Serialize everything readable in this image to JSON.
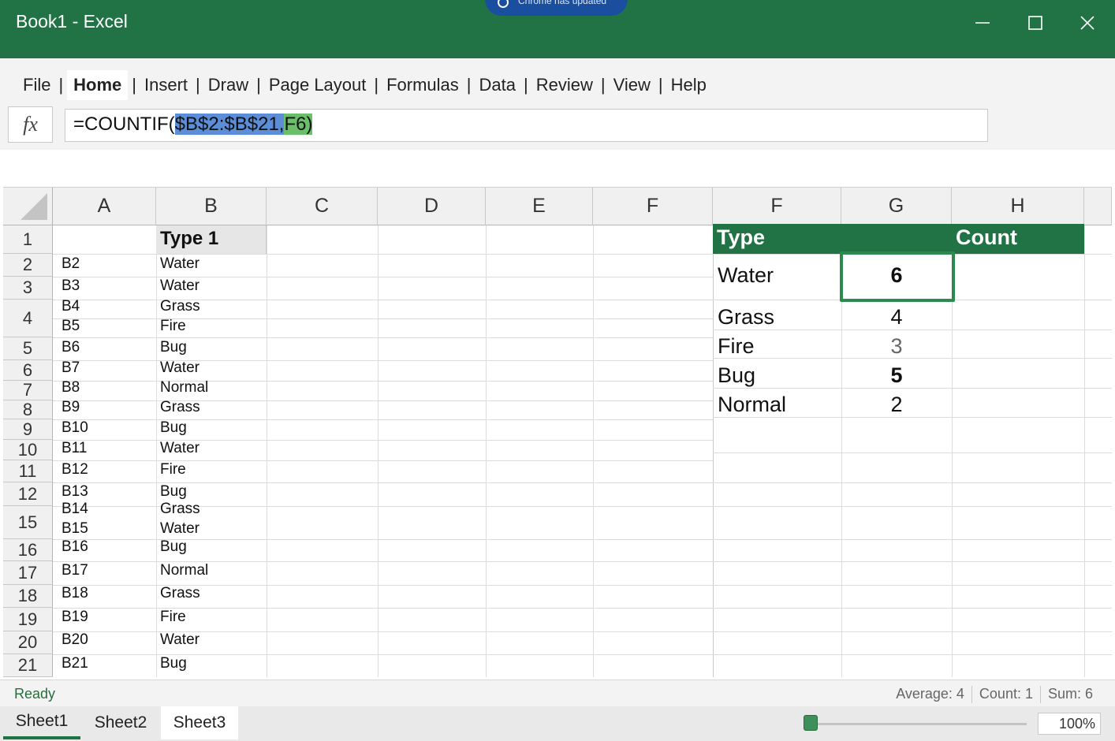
{
  "window": {
    "title": "Book1 - Excel",
    "notification": "Chrome has updated"
  },
  "menu": {
    "items": [
      "File",
      "Home",
      "Insert",
      "Draw",
      "Page Layout",
      "Formulas",
      "Data",
      "Review",
      "View",
      "Help"
    ],
    "active": "Home"
  },
  "formula_bar": {
    "fx_label": "fx",
    "prefix": "=COUNTIF(",
    "range_part": "$B$2:$B$21,",
    "criteria_part": "F6)"
  },
  "columns_left": [
    "A",
    "B",
    "C",
    "D",
    "E",
    "F"
  ],
  "columns_right": [
    "F",
    "G",
    "H"
  ],
  "row_numbers": [
    "1",
    "2",
    "3",
    "4",
    "5",
    "6",
    "7",
    "8",
    "9",
    "10",
    "11",
    "12",
    "15",
    "16",
    "17",
    "18",
    "19",
    "20",
    "21"
  ],
  "sheet": {
    "b1_header": "Type 1",
    "col_a": [
      "B2",
      "B3",
      "B4",
      "B5",
      "B6",
      "B7",
      "B8",
      "B9",
      "B10",
      "B11",
      "B12",
      "B13",
      "B14",
      "B15",
      "B16",
      "B17",
      "B18",
      "B19",
      "B20",
      "B21"
    ],
    "col_b": [
      "Water",
      "Water",
      "Grass",
      "Fire",
      "Bug",
      "Water",
      "Normal",
      "Grass",
      "Bug",
      "Water",
      "Fire",
      "Bug",
      "Grass",
      "Water",
      "Bug",
      "Normal",
      "Grass",
      "Fire",
      "Water",
      "Bug"
    ]
  },
  "summary_table": {
    "header_type": "Type",
    "header_count": "Count",
    "rows": [
      {
        "type": "Water",
        "count": "6"
      },
      {
        "type": "Grass",
        "count": "4"
      },
      {
        "type": "Fire",
        "count": "3"
      },
      {
        "type": "Bug",
        "count": "5"
      },
      {
        "type": "Normal",
        "count": "2"
      }
    ]
  },
  "status": {
    "ready": "Ready",
    "average": "Average: 4",
    "count": "Count: 1",
    "sum": "Sum: 6"
  },
  "tabs": [
    "Sheet1",
    "Sheet2",
    "Sheet3"
  ],
  "zoom": {
    "label": "100%",
    "level": 0.03
  },
  "colors": {
    "brand": "#217346",
    "range_highlight": "#5b8dd9",
    "criteria_highlight": "#6abf69"
  }
}
